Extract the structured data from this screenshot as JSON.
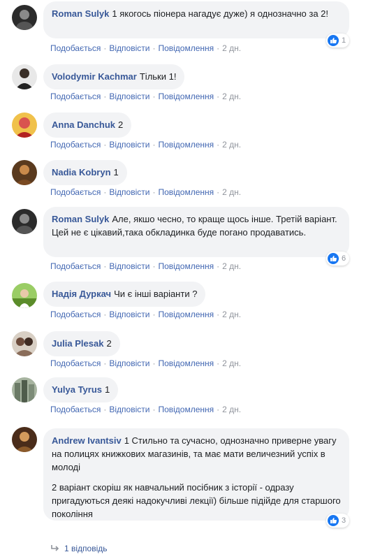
{
  "actions": {
    "like": "Подобається",
    "reply": "Відповісти",
    "message": "Повідомлення",
    "time": "2 дн.",
    "separator": "·"
  },
  "comments": [
    {
      "author": "Roman Sulyk",
      "paragraphs": [
        "1 якогось піонера нагадує дуже) я однозначно за 2!"
      ],
      "reactions": "1",
      "reaction_icon": "like-icon"
    },
    {
      "author": "Volodymir Kachmar",
      "paragraphs": [
        "Тільки 1!"
      ]
    },
    {
      "author": "Anna Danchuk",
      "paragraphs": [
        "2"
      ]
    },
    {
      "author": "Nadia Kobryn",
      "paragraphs": [
        "1"
      ]
    },
    {
      "author": "Roman Sulyk",
      "paragraphs": [
        "Але, якшо чесно, то краще щось інше. Третій варіант. Цей не є цікавий,така обкладинка буде погано продаватись."
      ],
      "reactions": "6",
      "reaction_icon": "like-icon"
    },
    {
      "author": "Надія Дуркач",
      "paragraphs": [
        "Чи є інші варіанти ?"
      ]
    },
    {
      "author": "Julia Plesak",
      "paragraphs": [
        "2"
      ]
    },
    {
      "author": "Yulya Tyrus",
      "paragraphs": [
        "1"
      ]
    },
    {
      "author": "Andrew Ivantsiv",
      "paragraphs": [
        "1 Стильно та сучасно, однозначно приверне увагу на полицях книжкових магазинів, та має мати величезний успіх в молоді",
        "2 варіант скоріш як навчальний посібник з історії - одразу пригадуються деякі надокучливі лекції) більше підійде для старшого покоління"
      ],
      "reactions": "3",
      "reaction_icon": "like-icon"
    }
  ],
  "replies_link": "1 відповідь",
  "colors": {
    "author": "#385898",
    "link": "#4267b2",
    "bubble": "#f2f3f5",
    "meta": "#90949c",
    "like": "#1877f2"
  }
}
